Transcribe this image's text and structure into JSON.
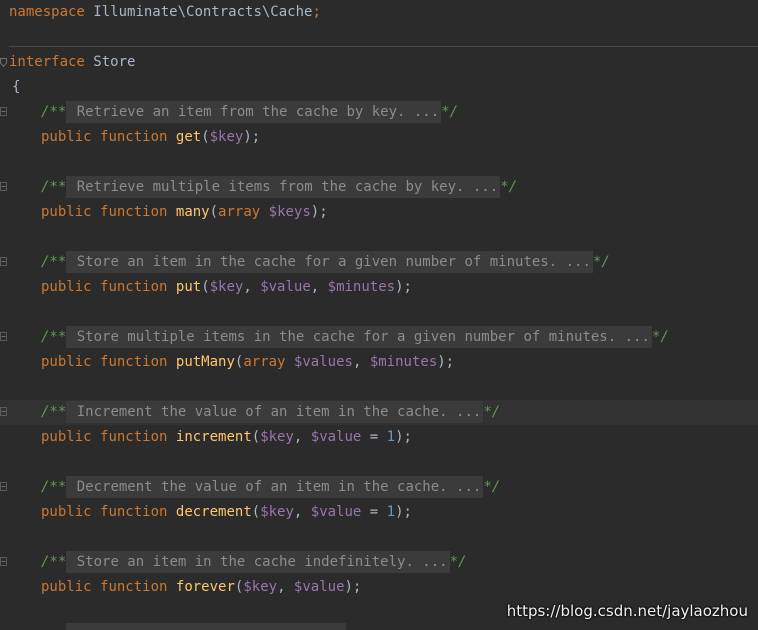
{
  "namespace_line": {
    "keyword": "namespace",
    "name": "Illuminate\\Contracts\\Cache",
    "terminator": ";"
  },
  "interface_line": {
    "keyword": "interface",
    "name": "Store"
  },
  "open_brace": "{",
  "methods": [
    {
      "doc": " Retrieve an item from the cache by key. ...",
      "public": "public",
      "function": "function",
      "name": "get",
      "open": "(",
      "params": [
        {
          "type": "",
          "var": "$key",
          "default_op": "",
          "default": ""
        }
      ],
      "close": ");"
    },
    {
      "doc": " Retrieve multiple items from the cache by key. ...",
      "public": "public",
      "function": "function",
      "name": "many",
      "open": "(",
      "params": [
        {
          "type": "array",
          "var": "$keys",
          "default_op": "",
          "default": ""
        }
      ],
      "close": ");"
    },
    {
      "doc": " Store an item in the cache for a given number of minutes. ...",
      "public": "public",
      "function": "function",
      "name": "put",
      "open": "(",
      "params": [
        {
          "type": "",
          "var": "$key",
          "default_op": "",
          "default": ""
        },
        {
          "type": "",
          "var": "$value",
          "default_op": "",
          "default": ""
        },
        {
          "type": "",
          "var": "$minutes",
          "default_op": "",
          "default": ""
        }
      ],
      "close": ");"
    },
    {
      "doc": " Store multiple items in the cache for a given number of minutes. ...",
      "public": "public",
      "function": "function",
      "name": "putMany",
      "open": "(",
      "params": [
        {
          "type": "array",
          "var": "$values",
          "default_op": "",
          "default": ""
        },
        {
          "type": "",
          "var": "$minutes",
          "default_op": "",
          "default": ""
        }
      ],
      "close": ");"
    },
    {
      "doc": " Increment the value of an item in the cache. ...",
      "public": "public",
      "function": "function",
      "name": "increment",
      "open": "(",
      "params": [
        {
          "type": "",
          "var": "$key",
          "default_op": "",
          "default": ""
        },
        {
          "type": "",
          "var": "$value",
          "default_op": " = ",
          "default": "1"
        }
      ],
      "close": ");"
    },
    {
      "doc": " Decrement the value of an item in the cache. ...",
      "public": "public",
      "function": "function",
      "name": "decrement",
      "open": "(",
      "params": [
        {
          "type": "",
          "var": "$key",
          "default_op": "",
          "default": ""
        },
        {
          "type": "",
          "var": "$value",
          "default_op": " = ",
          "default": "1"
        }
      ],
      "close": ");"
    },
    {
      "doc": " Store an item in the cache indefinitely. ...",
      "public": "public",
      "function": "function",
      "name": "forever",
      "open": "(",
      "params": [
        {
          "type": "",
          "var": "$key",
          "default_op": "",
          "default": ""
        },
        {
          "type": "",
          "var": "$value",
          "default_op": "",
          "default": ""
        }
      ],
      "close": ");"
    }
  ],
  "comment_open": "/**",
  "comment_close": "*/",
  "param_separator": ", ",
  "current_line_method_index": 4,
  "watermark": "https://blog.csdn.net/jaylaozhou",
  "colors": {
    "background": "#2b2b2b",
    "keyword": "#cc7832",
    "function_name": "#ffc66d",
    "variable": "#9876aa",
    "number": "#6897bb",
    "comment": "#629755",
    "folded_text": "#8c8c8c"
  }
}
